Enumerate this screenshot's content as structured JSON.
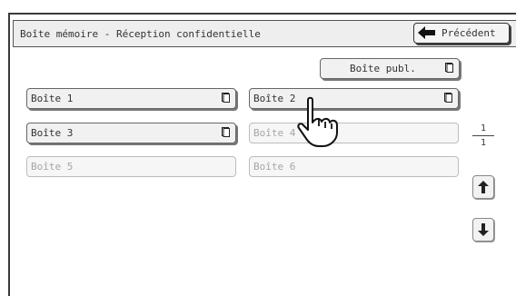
{
  "header": {
    "title": "Boîte mémoire - Réception confidentielle",
    "back_label": "Précédent"
  },
  "public_box": {
    "label": "Boîte publ."
  },
  "boxes": [
    {
      "label": "Boîte 1",
      "enabled": true,
      "has_doc_icon": true
    },
    {
      "label": "Boîte 2",
      "enabled": true,
      "has_doc_icon": true
    },
    {
      "label": "Boîte 3",
      "enabled": true,
      "has_doc_icon": true
    },
    {
      "label": "Boîte 4",
      "enabled": false,
      "has_doc_icon": false
    },
    {
      "label": "Boîte 5",
      "enabled": false,
      "has_doc_icon": false
    },
    {
      "label": "Boîte 6",
      "enabled": false,
      "has_doc_icon": false
    }
  ],
  "pager": {
    "current": "1",
    "total": "1"
  },
  "icons": {
    "back": "left-arrow-icon",
    "doc": "document-icon",
    "up": "scroll-up-icon",
    "down": "scroll-down-icon",
    "pointer": "pointing-hand-icon"
  }
}
